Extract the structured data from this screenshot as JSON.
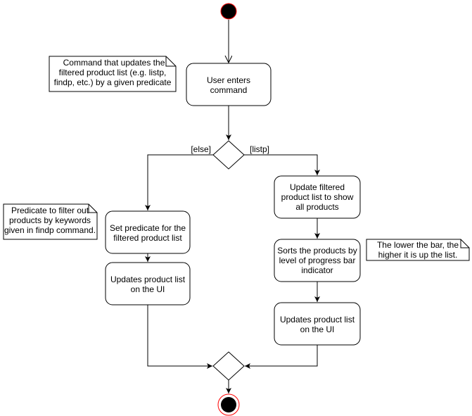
{
  "colors": {
    "node_stroke": "#000000",
    "start_end_stroke": "#ff0000",
    "fill": "#ffffff",
    "initial_fill": "#000000"
  },
  "nodes": {
    "user_enters": [
      "User enters",
      "command"
    ],
    "set_predicate": [
      "Set predicate for the",
      "filtered product list"
    ],
    "updates_left": [
      "Updates product list",
      "on the UI"
    ],
    "update_filtered": [
      "Update filtered",
      "product list to show",
      "all products"
    ],
    "sorts": [
      "Sorts the products by",
      "level of progress bar",
      "indicator"
    ],
    "updates_right": [
      "Updates product list",
      "on the UI"
    ]
  },
  "guards": {
    "else": "[else]",
    "listp": "[listp]"
  },
  "notes": {
    "command": [
      "Command that updates the",
      "filtered product list (e.g. listp,",
      "findp, etc.) by a given predicate"
    ],
    "predicate": [
      "Predicate to filter out",
      "products by keywords",
      "given in findp command."
    ],
    "lower_bar": [
      "The lower the bar, the",
      "higher it is up the list."
    ]
  }
}
